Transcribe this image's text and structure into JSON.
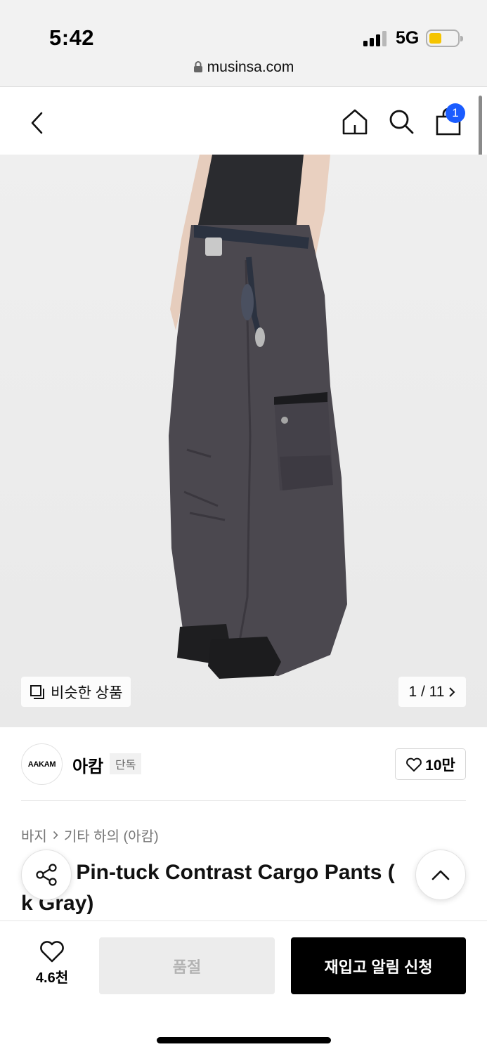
{
  "status_bar": {
    "time": "5:42",
    "network": "5G",
    "url": "musinsa.com",
    "battery_color": "#f5c400"
  },
  "nav": {
    "cart_count": "1",
    "icons": [
      "back-icon",
      "home-icon",
      "search-icon",
      "cart-icon"
    ],
    "badge_color": "#1a5cff"
  },
  "gallery": {
    "similar_label": "비슷한 상품",
    "counter": "1 / 11"
  },
  "brand": {
    "logo_text": "AAKAM",
    "name": "아캄",
    "tag": "단독",
    "likes": "10만"
  },
  "breadcrumb": {
    "category": "바지",
    "subcategory": "기타 하의 (아캄)"
  },
  "product": {
    "title_line1": "· Pin-tuck Contrast Cargo Pants (",
    "title_line2": "k Gray)"
  },
  "bottom_bar": {
    "wish_count": "4.6천",
    "soldout_label": "품절",
    "restock_label": "재입고 알림 신청"
  }
}
